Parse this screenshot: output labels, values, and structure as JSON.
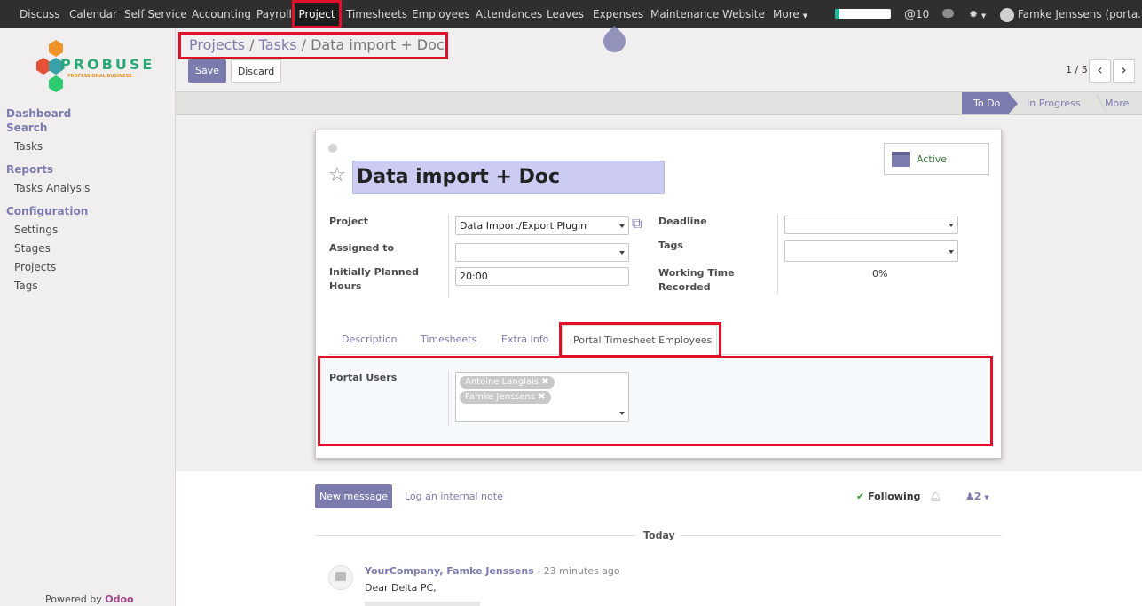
{
  "topbar": {
    "menu": [
      "Discuss",
      "Calendar",
      "Self Service",
      "Accounting",
      "Payroll",
      "Project",
      "Timesheets",
      "Employees",
      "Attendances",
      "Leaves",
      "Expenses",
      "Maintenance",
      "Website",
      "More"
    ],
    "active_menu": "Project",
    "mentions_count": "10",
    "user": "Famke Jenssens (porta...",
    "highlight_color": "#e0102b"
  },
  "sidebar": {
    "logo_text": "PROBUSE",
    "logo_sub": "PROFESSIONAL BUSINESS",
    "sections": [
      {
        "title": "Dashboard",
        "items": []
      },
      {
        "title": "Search",
        "items": [
          "Tasks"
        ]
      },
      {
        "title": "Reports",
        "items": [
          "Tasks Analysis"
        ]
      },
      {
        "title": "Configuration",
        "items": [
          "Settings",
          "Stages",
          "Projects",
          "Tags"
        ]
      }
    ],
    "powered_prefix": "Powered by ",
    "powered_brand": "Odoo"
  },
  "breadcrumb": {
    "items": [
      "Projects",
      "Tasks"
    ],
    "separator": "/",
    "current": "Data import + Doc"
  },
  "buttons": {
    "save": "Save",
    "discard": "Discard"
  },
  "pager": {
    "value": "1 / 5",
    "prev": "‹",
    "next": "›"
  },
  "stages": {
    "current": "To Do",
    "next": "In Progress",
    "more": "More"
  },
  "form": {
    "active_label": "Active",
    "title": "Data import + Doc",
    "project_label": "Project",
    "project_value": "Data Import/Export Plugin",
    "assigned_label": "Assigned to",
    "assigned_value": "",
    "planned_label": "Initially Planned Hours",
    "planned_value": "20:00",
    "deadline_label": "Deadline",
    "deadline_value": "",
    "tags_label": "Tags",
    "tags_value": "",
    "working_label": "Working Time Recorded",
    "working_value": "0%",
    "tabs": [
      "Description",
      "Timesheets",
      "Extra Info",
      "Portal Timesheet Employees"
    ],
    "active_tab": "Portal Timesheet Employees",
    "portal_users_label": "Portal Users",
    "portal_users": [
      "Antoine Langlais",
      "Famke Jenssens"
    ]
  },
  "chatter": {
    "new_message": "New message",
    "log_note": "Log an internal note",
    "following": "Following",
    "followers_count": "2",
    "date_separator": "Today",
    "message": {
      "author": "YourCompany, Famke Jenssens",
      "time": "- 23 minutes ago",
      "body": "Dear Delta PC,"
    }
  },
  "colors": {
    "accent": "#7c7bad",
    "topbar": "#2f2f2f",
    "highlight": "#e0102b"
  }
}
